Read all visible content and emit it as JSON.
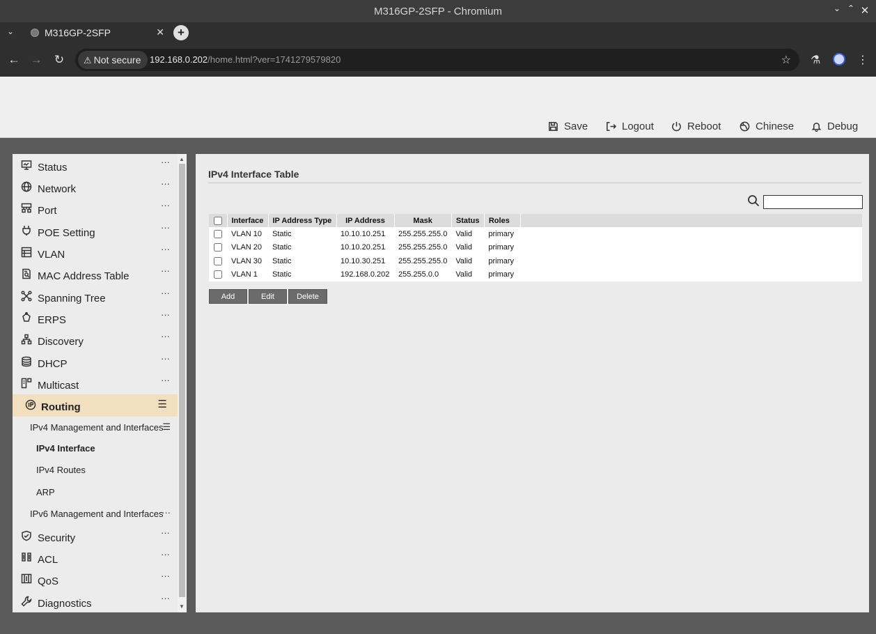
{
  "window": {
    "title": "M316GP-2SFP - Chromium",
    "controls": [
      "minimize",
      "maximize",
      "close"
    ]
  },
  "tab": {
    "title": "M316GP-2SFP"
  },
  "omnibox": {
    "security_label": "Not secure",
    "url_host": "192.168.0.202",
    "url_path": "/home.html?ver=1741279579820"
  },
  "header": {
    "buttons": [
      {
        "label": "Save",
        "icon": "floppy-disk-icon"
      },
      {
        "label": "Logout",
        "icon": "logout-icon"
      },
      {
        "label": "Reboot",
        "icon": "power-icon"
      },
      {
        "label": "Chinese",
        "icon": "globe-language-icon"
      },
      {
        "label": "Debug",
        "icon": "bell-icon"
      }
    ]
  },
  "sidebar": {
    "items": [
      {
        "label": "Status",
        "icon": "monitor-icon"
      },
      {
        "label": "Network",
        "icon": "globe-icon"
      },
      {
        "label": "Port",
        "icon": "port-grid-icon"
      },
      {
        "label": "POE Setting",
        "icon": "plug-icon"
      },
      {
        "label": "VLAN",
        "icon": "list-box-icon"
      },
      {
        "label": "MAC Address Table",
        "icon": "document-search-icon"
      },
      {
        "label": "Spanning Tree",
        "icon": "tree-nodes-icon"
      },
      {
        "label": "ERPS",
        "icon": "ring-icon"
      },
      {
        "label": "Discovery",
        "icon": "hierarchy-icon"
      },
      {
        "label": "DHCP",
        "icon": "database-icon"
      },
      {
        "label": "Multicast",
        "icon": "multicast-icon"
      },
      {
        "label": "Routing",
        "icon": "ip-circle-icon"
      },
      {
        "label": "Security",
        "icon": "shield-icon"
      },
      {
        "label": "ACL",
        "icon": "acl-icon"
      },
      {
        "label": "QoS",
        "icon": "qos-icon"
      },
      {
        "label": "Diagnostics",
        "icon": "wrench-icon"
      }
    ],
    "more_glyph": "···",
    "expand_glyph": "☰",
    "routing_sub": {
      "ipv4_group": "IPv4 Management and Interfaces",
      "ipv4_interface": "IPv4 Interface",
      "ipv4_routes": "IPv4 Routes",
      "arp": "ARP",
      "ipv6_group": "IPv6 Management and Interfaces"
    }
  },
  "main": {
    "title": "IPv4 Interface Table",
    "search": {
      "value": "",
      "placeholder": ""
    },
    "table": {
      "columns": [
        "Interface",
        "IP Address Type",
        "IP Address",
        "Mask",
        "Status",
        "Roles"
      ],
      "rows": [
        [
          "VLAN 10",
          "Static",
          "10.10.10.251",
          "255.255.255.0",
          "Valid",
          "primary"
        ],
        [
          "VLAN 20",
          "Static",
          "10.10.20.251",
          "255.255.255.0",
          "Valid",
          "primary"
        ],
        [
          "VLAN 30",
          "Static",
          "10.10.30.251",
          "255.255.255.0",
          "Valid",
          "primary"
        ],
        [
          "VLAN 1",
          "Static",
          "192.168.0.202",
          "255.255.0.0",
          "Valid",
          "primary"
        ]
      ]
    },
    "actions": {
      "add": "Add",
      "edit": "Edit",
      "delete": "Delete"
    }
  }
}
